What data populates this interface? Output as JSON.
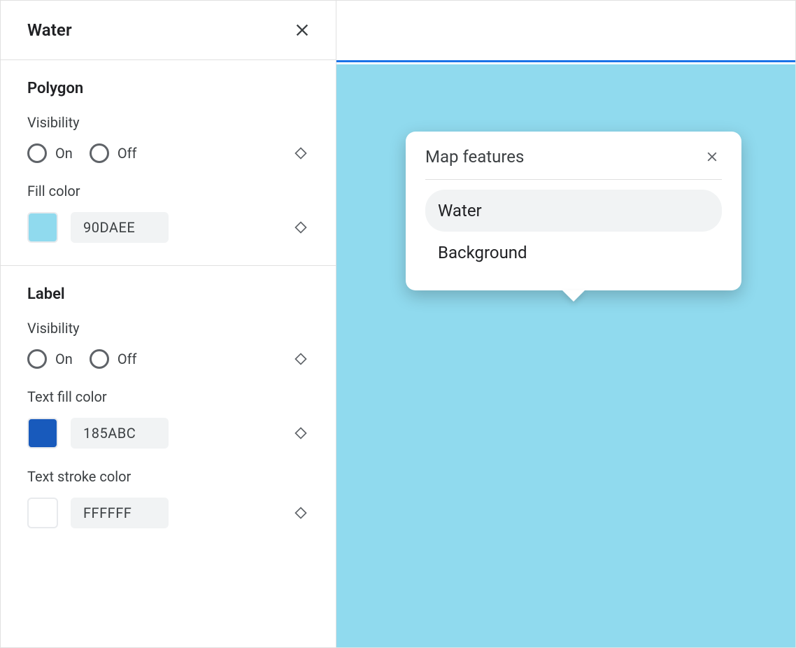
{
  "panel": {
    "title": "Water",
    "sections": {
      "polygon": {
        "title": "Polygon",
        "visibility_label": "Visibility",
        "on": "On",
        "off": "Off",
        "fill_color_label": "Fill color",
        "fill_color_hex": "90DAEE",
        "fill_color_value": "#90DAEE"
      },
      "label": {
        "title": "Label",
        "visibility_label": "Visibility",
        "on": "On",
        "off": "Off",
        "text_fill_label": "Text fill color",
        "text_fill_hex": "185ABC",
        "text_fill_value": "#185ABC",
        "text_stroke_label": "Text stroke color",
        "text_stroke_hex": "FFFFFF",
        "text_stroke_value": "#FFFFFF"
      }
    }
  },
  "preview": {
    "water_color": "#90DAEE",
    "accent_color": "#1a73e8"
  },
  "popup": {
    "title": "Map features",
    "items": {
      "water": "Water",
      "background": "Background"
    }
  }
}
